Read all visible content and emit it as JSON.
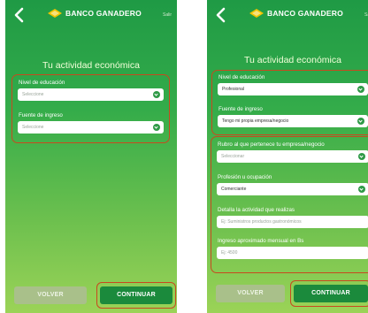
{
  "brand": {
    "name": "BANCO GANADERO",
    "exit_label": "Salir"
  },
  "screen1": {
    "title": "Tu actividad económica",
    "fields": [
      {
        "label": "Nivel de educación",
        "value": "Seleccione"
      },
      {
        "label": "Fuente de ingreso",
        "value": "Seleccione"
      }
    ],
    "buttons": {
      "back": "VOLVER",
      "continue": "CONTINUAR"
    }
  },
  "screen2": {
    "title": "Tu actividad económica",
    "fields": [
      {
        "label": "Nivel de educación",
        "value": "Profesional"
      },
      {
        "label": "Fuente de ingreso",
        "value": "Tengo mi propia empresa/negocio"
      },
      {
        "label": "Rubro al que pertenece tu empresa/negocio",
        "value": "Seleccionar"
      },
      {
        "label": "Profesión u ocupación",
        "value": "Comerciante"
      },
      {
        "label": "Detalla la actividad que realizas",
        "placeholder": "Ej: Suministros productos gastronómicos"
      },
      {
        "label": "Ingreso aproximado mensual en Bs",
        "placeholder": "Ej: 4500"
      }
    ],
    "buttons": {
      "back": "VOLVER",
      "continue": "CONTINUAR"
    }
  },
  "colors": {
    "brand_green": "#1f9a45",
    "highlight_orange": "#c8491f",
    "button_disabled": "#a9c08a"
  }
}
